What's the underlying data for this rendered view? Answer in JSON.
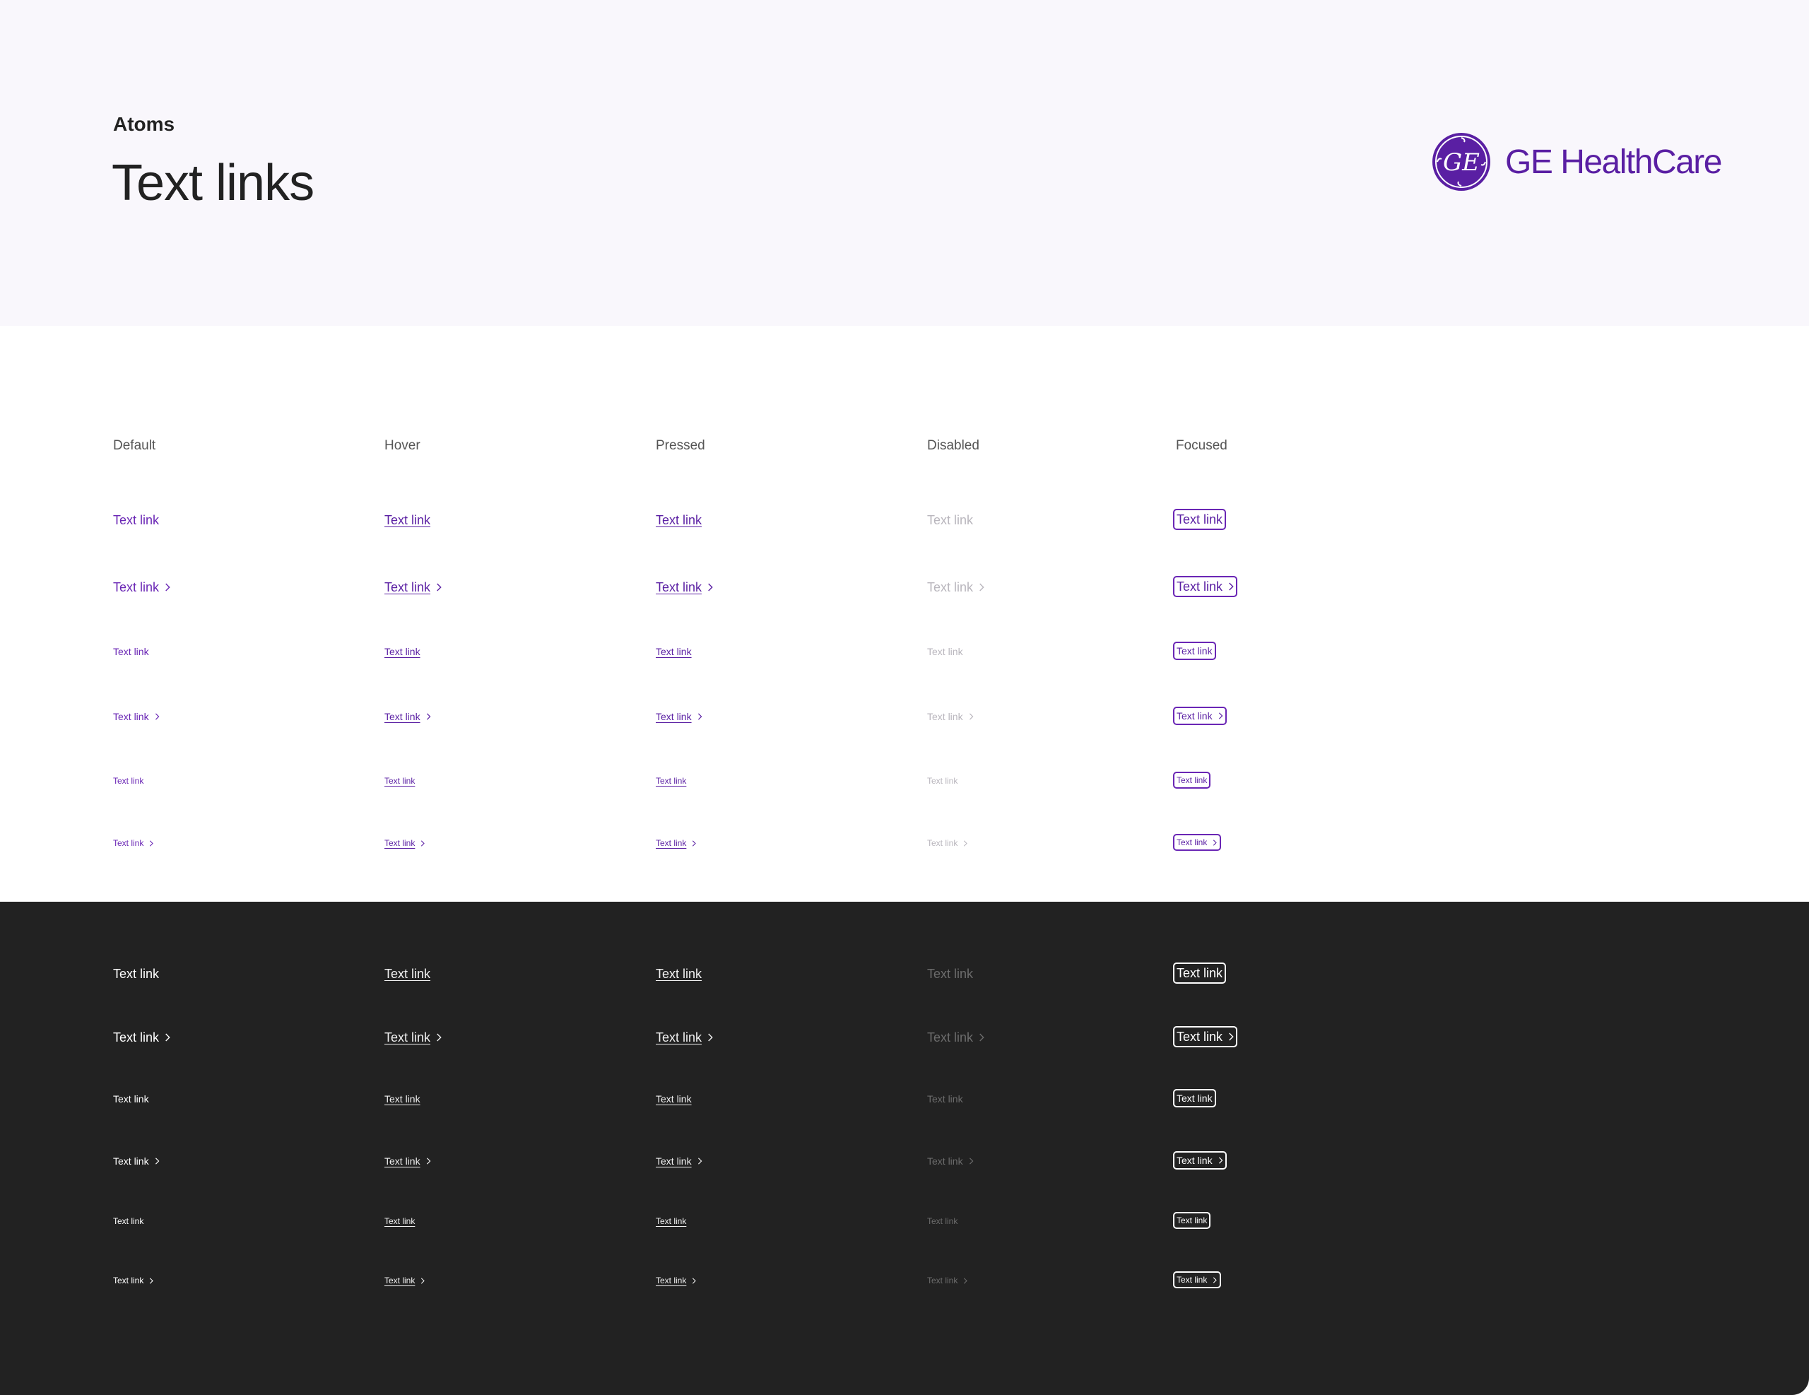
{
  "header": {
    "eyebrow": "Atoms",
    "title": "Text links",
    "logo_text": "GE HealthCare",
    "logo_monogram": "GE"
  },
  "colors": {
    "brand_purple": "#6a26b5",
    "header_background": "#f9f7fc",
    "dark_background": "#222222"
  },
  "columns": [
    {
      "state": "default",
      "label": "Default"
    },
    {
      "state": "hover",
      "label": "Hover"
    },
    {
      "state": "pressed",
      "label": "Pressed"
    },
    {
      "state": "disabled",
      "label": "Disabled"
    },
    {
      "state": "focused",
      "label": "Focused"
    }
  ],
  "link": {
    "label": "Text link",
    "chevron_icon": "chevron-right-icon"
  },
  "rows": [
    {
      "size": "large",
      "chevron": false
    },
    {
      "size": "large",
      "chevron": true
    },
    {
      "size": "medium",
      "chevron": false
    },
    {
      "size": "medium",
      "chevron": true
    },
    {
      "size": "small",
      "chevron": false
    },
    {
      "size": "small",
      "chevron": true
    }
  ],
  "themes": [
    "light",
    "dark"
  ]
}
